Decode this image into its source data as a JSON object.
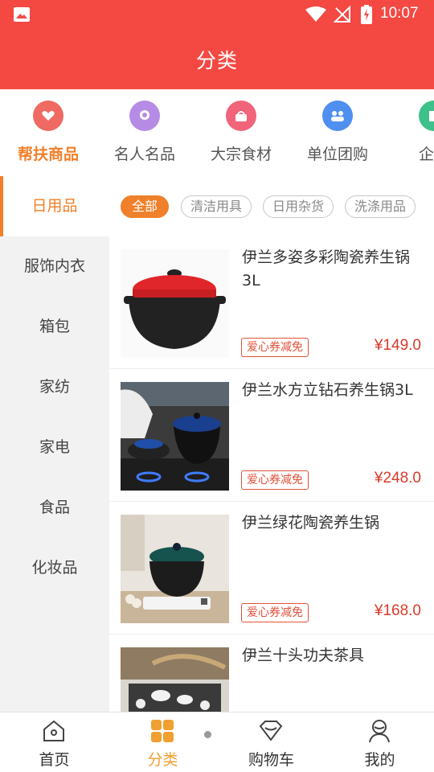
{
  "status_bar": {
    "time": "10:07"
  },
  "header": {
    "title": "分类"
  },
  "top_categories": [
    {
      "label": "帮扶商品",
      "icon": "heart-hands-icon",
      "color": "#ef6a62",
      "active": true
    },
    {
      "label": "名人名品",
      "icon": "badge-icon",
      "color": "#b68be6",
      "active": false
    },
    {
      "label": "大宗食材",
      "icon": "basket-icon",
      "color": "#f1647a",
      "active": false
    },
    {
      "label": "单位团购",
      "icon": "group-icon",
      "color": "#4f8ff0",
      "active": false
    },
    {
      "label": "企业",
      "icon": "enterprise-icon",
      "color": "#3ec08a",
      "active": false
    }
  ],
  "sidebar": {
    "items": [
      {
        "label": "日用品",
        "active": true
      },
      {
        "label": "服饰内衣"
      },
      {
        "label": "箱包"
      },
      {
        "label": "家纺"
      },
      {
        "label": "家电"
      },
      {
        "label": "食品"
      },
      {
        "label": "化妆品"
      }
    ]
  },
  "filters": [
    {
      "label": "全部",
      "active": true
    },
    {
      "label": "清洁用具"
    },
    {
      "label": "日用杂货"
    },
    {
      "label": "洗涤用品"
    }
  ],
  "products": [
    {
      "name": "伊兰多姿多彩陶瓷养生锅3L",
      "tag": "爱心券减免",
      "price": "¥149.0"
    },
    {
      "name": "伊兰水方立钻石养生锅3L",
      "tag": "爱心券减免",
      "price": "¥248.0"
    },
    {
      "name": "伊兰绿花陶瓷养生锅",
      "tag": "爱心券减免",
      "price": "¥168.0"
    },
    {
      "name": "伊兰十头功夫茶具",
      "tag": "",
      "price": ""
    }
  ],
  "bottom_nav": [
    {
      "label": "首页",
      "icon": "home-icon"
    },
    {
      "label": "分类",
      "icon": "category-grid-icon",
      "active": true
    },
    {
      "label": "购物车",
      "icon": "cart-diamond-icon"
    },
    {
      "label": "我的",
      "icon": "profile-icon"
    }
  ],
  "colors": {
    "header": "#f44843",
    "accent": "#f0802a",
    "price": "#d93a2a"
  }
}
